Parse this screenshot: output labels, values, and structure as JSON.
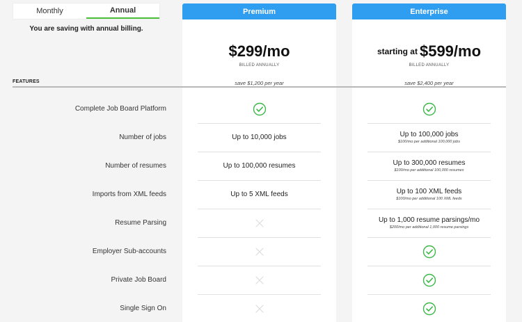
{
  "billing_toggle": {
    "options": [
      {
        "label": "Monthly",
        "active": false
      },
      {
        "label": "Annual",
        "active": true
      }
    ],
    "note": "You are saving with annual billing."
  },
  "plans": [
    {
      "name": "Premium",
      "price_prefix": "",
      "price": "$299/mo",
      "billed": "BILLED ANNUALLY",
      "savings": "save $1,200 per year"
    },
    {
      "name": "Enterprise",
      "price_prefix": "starting at",
      "price": "$599/mo",
      "billed": "BILLED ANNUALLY",
      "savings": "save $2,400 per year"
    }
  ],
  "features_heading": "FEATURES",
  "features": [
    {
      "label": "Complete Job Board Platform",
      "premium": {
        "type": "check"
      },
      "enterprise": {
        "type": "check"
      }
    },
    {
      "label": "Number of jobs",
      "premium": {
        "type": "text",
        "text": "Up to 10,000 jobs"
      },
      "enterprise": {
        "type": "text",
        "text": "Up to 100,000 jobs",
        "sub": "$100/mo per additional 100,000 jobs"
      }
    },
    {
      "label": "Number of resumes",
      "premium": {
        "type": "text",
        "text": "Up to 100,000 resumes"
      },
      "enterprise": {
        "type": "text",
        "text": "Up to 300,000 resumes",
        "sub": "$100/mo per additional 100,000 resumes"
      }
    },
    {
      "label": "Imports from XML feeds",
      "premium": {
        "type": "text",
        "text": "Up to 5 XML feeds"
      },
      "enterprise": {
        "type": "text",
        "text": "Up to 100 XML feeds",
        "sub": "$100/mo per additional 100 XML feeds"
      }
    },
    {
      "label": "Resume Parsing",
      "premium": {
        "type": "x"
      },
      "enterprise": {
        "type": "text",
        "text": "Up to 1,000 resume parsings/mo",
        "sub": "$200/mo per additional 1,000 resume parsings"
      }
    },
    {
      "label": "Employer Sub-accounts",
      "premium": {
        "type": "x"
      },
      "enterprise": {
        "type": "check"
      }
    },
    {
      "label": "Private Job Board",
      "premium": {
        "type": "x"
      },
      "enterprise": {
        "type": "check"
      }
    },
    {
      "label": "Single Sign On",
      "premium": {
        "type": "x"
      },
      "enterprise": {
        "type": "check"
      }
    }
  ],
  "icons": {
    "check": "check-circle-icon",
    "x": "x-icon"
  },
  "colors": {
    "header": "#2f9df0",
    "check": "#3cb84a",
    "toggle_active": "#4bbf3a",
    "x": "#dddddd"
  }
}
